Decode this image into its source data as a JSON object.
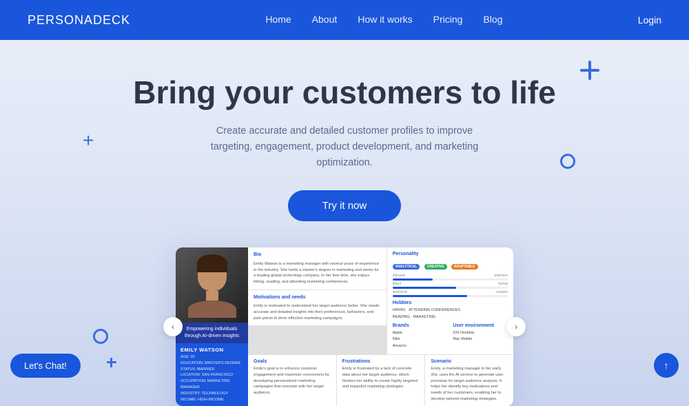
{
  "navbar": {
    "logo_bold": "PERSONA",
    "logo_light": "DECK",
    "links": [
      {
        "label": "Home",
        "href": "#"
      },
      {
        "label": "About",
        "href": "#"
      },
      {
        "label": "How it works",
        "href": "#"
      },
      {
        "label": "Pricing",
        "href": "#"
      },
      {
        "label": "Blog",
        "href": "#"
      }
    ],
    "login_label": "Login"
  },
  "hero": {
    "title": "Bring your customers to life",
    "subtitle": "Create accurate and detailed customer profiles to improve targeting, engagement, product development, and marketing optimization.",
    "cta_label": "Try it now"
  },
  "persona_card": {
    "tagline": "Empowering individuals through AI-driven insights",
    "name": "EMILY WATSON",
    "details": [
      "AGE: 32",
      "EDUCATION: MASTER'S DEGREE",
      "STATUS: MARRIED",
      "LOCATION: SAN FRANCISCO",
      "OCCUPATION: MARKETING MANAGER",
      "INDUSTRY: TECHNOLOGY",
      "INCOME: HIGH-INCOME"
    ],
    "bio_title": "Bio",
    "bio_text": "Emily Watson is a marketing manager with several years of experience in the industry. She holds a master's degree in marketing and works for a leading global technology company. In her free time, she enjoys hiking, reading, and attending marketing conferences.",
    "motiv_title": "Motivations and needs",
    "motiv_text": "Emily is motivated to understand her target audience better. She needs accurate and detailed insights into their preferences, behaviors, and pain points to drive effective marketing campaigns.",
    "personality_title": "Personality",
    "traits": [
      {
        "left": "introvert",
        "right": "extrovert",
        "value": 35
      },
      {
        "left": "direct",
        "right": "formal",
        "value": 55
      },
      {
        "left": "analytical",
        "right": "creative",
        "value": 65
      }
    ],
    "tags": [
      {
        "label": "ANALYTICAL",
        "color": "#3b6be0"
      },
      {
        "label": "CREATIVE",
        "color": "#27ae60"
      },
      {
        "label": "ADAPTABLE",
        "color": "#e67e22"
      }
    ],
    "hobbies_title": "Hobbies",
    "hobbies": [
      "HIKING",
      "ATTENDING CONFERENCES",
      "READING",
      "MARKETING"
    ],
    "brands_title": "Brands",
    "brands": [
      "Apple",
      "Nike",
      "Amazon"
    ],
    "user_env_title": "User environment",
    "user_env": [
      "iOS Desktop",
      "Mac Mobile"
    ],
    "goals_title": "Goals",
    "goals_text": "Emily's goal is to enhance customer engagement and maximize conversions by developing personalized marketing campaigns that resonate with her target audience.",
    "frustrations_title": "Frustrations",
    "frustrations_text": "Emily is frustrated by a lack of concrete data about her target audience, which hinders her ability to create highly targeted and impactful marketing strategies.",
    "scenario_title": "Scenario",
    "scenario_text": "Emily, a marketing manager in her early 30s, uses the AI service to generate user personas for target audience analysis. It helps her identify key motivations and needs of her customers, enabling her to develop tailored marketing strategies."
  },
  "chat_button": "Let's Chat!",
  "scroll_top_icon": "↑"
}
